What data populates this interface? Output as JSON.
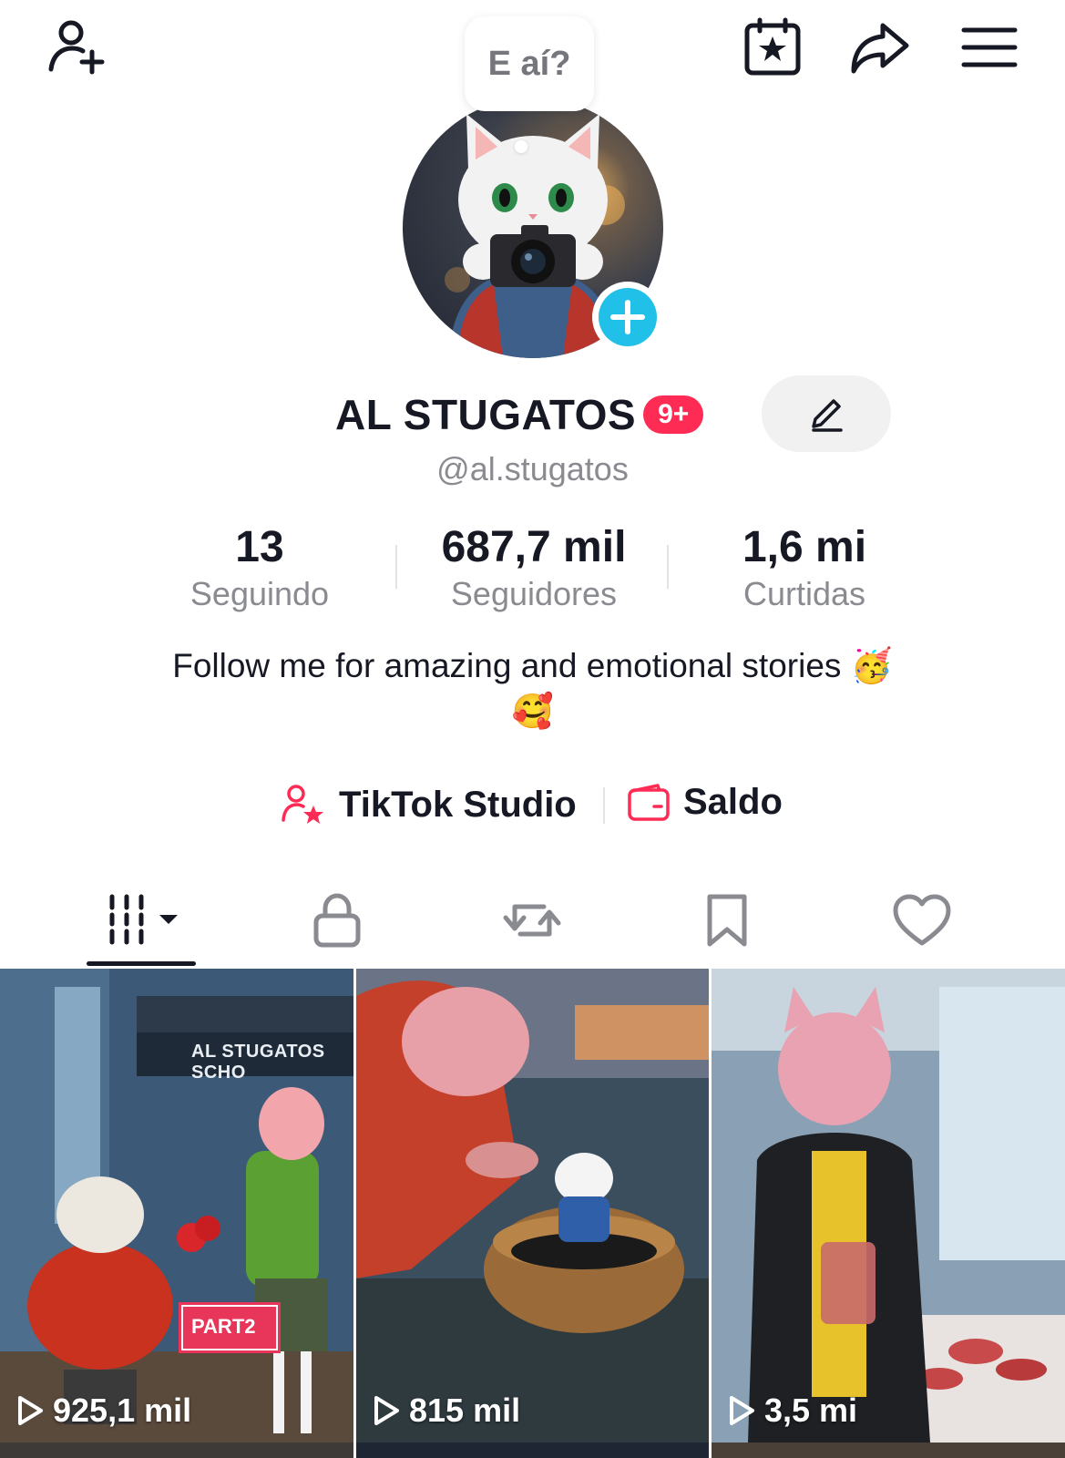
{
  "header": {
    "add_friend_icon": "person-plus-icon",
    "calendar_icon": "calendar-star-icon",
    "share_icon": "share-arrow-icon",
    "menu_icon": "hamburger-menu-icon"
  },
  "status_bubble": {
    "text": "E aí?"
  },
  "profile": {
    "name": "AL STUGATOS",
    "badge": "9+",
    "handle": "@al.stugatos",
    "bio_line1": "Follow me for amazing and emotional stories 🥳",
    "bio_line2": "🥰"
  },
  "stats": [
    {
      "value": "13",
      "label": "Seguindo"
    },
    {
      "value": "687,7 mil",
      "label": "Seguidores"
    },
    {
      "value": "1,6 mi",
      "label": "Curtidas"
    }
  ],
  "links": {
    "studio": "TikTok Studio",
    "balance": "Saldo"
  },
  "tabs": [
    {
      "name": "videos",
      "icon": "grid-icon"
    },
    {
      "name": "private",
      "icon": "lock-icon"
    },
    {
      "name": "reposts",
      "icon": "repost-icon"
    },
    {
      "name": "favorites",
      "icon": "bookmark-icon"
    },
    {
      "name": "liked",
      "icon": "heart-icon"
    }
  ],
  "videos": [
    {
      "views": "925,1 mil",
      "overlay_sign": "AL STUGATOS SCHO",
      "overlay_tag": "PART2"
    },
    {
      "views": "815 mil"
    },
    {
      "views": "3,5 mi"
    }
  ],
  "colors": {
    "accent": "#fe2c55",
    "plus_blue": "#20c0e8",
    "text": "#161823",
    "muted": "#8a8b91"
  }
}
